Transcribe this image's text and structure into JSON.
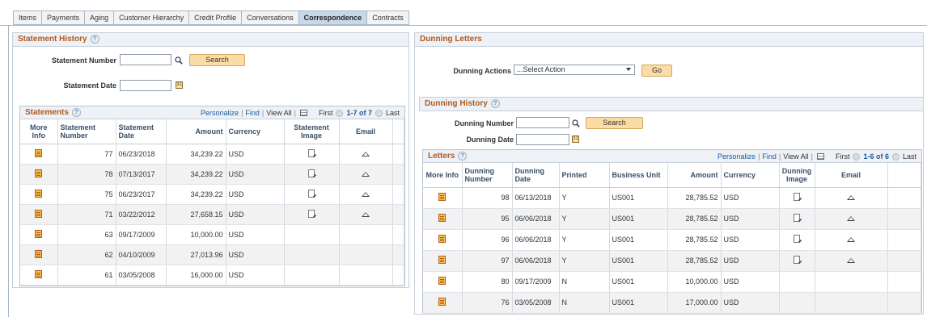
{
  "tabs": [
    "Items",
    "Payments",
    "Aging",
    "Customer Hierarchy",
    "Credit Profile",
    "Conversations",
    "Correspondence",
    "Contracts"
  ],
  "active_tab": "Correspondence",
  "statement_history": {
    "title": "Statement History",
    "help": "?",
    "statement_number_label": "Statement Number",
    "statement_date_label": "Statement Date",
    "search_label": "Search",
    "grid": {
      "title": "Statements",
      "personalize": "Personalize",
      "find": "Find",
      "view_all": "View All",
      "first": "First",
      "range": "1-7 of 7",
      "last": "Last",
      "headers": [
        "More Info",
        "Statement Number",
        "Statement Date",
        "Amount",
        "Currency",
        "Statement Image",
        "Email"
      ],
      "rows": [
        {
          "number": "77",
          "date": "06/23/2018",
          "amount": "34,239.22",
          "currency": "USD",
          "image": true,
          "email": true
        },
        {
          "number": "78",
          "date": "07/13/2017",
          "amount": "34,239.22",
          "currency": "USD",
          "image": true,
          "email": true
        },
        {
          "number": "75",
          "date": "06/23/2017",
          "amount": "34,239.22",
          "currency": "USD",
          "image": true,
          "email": true
        },
        {
          "number": "71",
          "date": "03/22/2012",
          "amount": "27,658.15",
          "currency": "USD",
          "image": true,
          "email": true
        },
        {
          "number": "63",
          "date": "09/17/2009",
          "amount": "10,000.00",
          "currency": "USD",
          "image": false,
          "email": false
        },
        {
          "number": "62",
          "date": "04/10/2009",
          "amount": "27,013.96",
          "currency": "USD",
          "image": false,
          "email": false
        },
        {
          "number": "61",
          "date": "03/05/2008",
          "amount": "16,000.00",
          "currency": "USD",
          "image": false,
          "email": false
        }
      ]
    }
  },
  "dunning_letters": {
    "title": "Dunning Letters",
    "actions_label": "Dunning Actions",
    "actions_value": "...Select Action",
    "go_label": "Go"
  },
  "dunning_history": {
    "title": "Dunning History",
    "help": "?",
    "number_label": "Dunning Number",
    "date_label": "Dunning Date",
    "search_label": "Search",
    "grid": {
      "title": "Letters",
      "personalize": "Personalize",
      "find": "Find",
      "view_all": "View All",
      "first": "First",
      "range": "1-6 of 6",
      "last": "Last",
      "headers": [
        "More Info",
        "Dunning Number",
        "Dunning Date",
        "Printed",
        "Business Unit",
        "Amount",
        "Currency",
        "Dunning Image",
        "Email"
      ],
      "rows": [
        {
          "number": "98",
          "date": "06/13/2018",
          "printed": "Y",
          "bu": "US001",
          "amount": "28,785.52",
          "currency": "USD",
          "image": true,
          "email": true
        },
        {
          "number": "95",
          "date": "06/06/2018",
          "printed": "Y",
          "bu": "US001",
          "amount": "28,785.52",
          "currency": "USD",
          "image": true,
          "email": true
        },
        {
          "number": "96",
          "date": "06/06/2018",
          "printed": "Y",
          "bu": "US001",
          "amount": "28,785.52",
          "currency": "USD",
          "image": true,
          "email": true
        },
        {
          "number": "97",
          "date": "06/06/2018",
          "printed": "Y",
          "bu": "US001",
          "amount": "28,785.52",
          "currency": "USD",
          "image": true,
          "email": true
        },
        {
          "number": "80",
          "date": "09/17/2009",
          "printed": "N",
          "bu": "US001",
          "amount": "10,000.00",
          "currency": "USD",
          "image": false,
          "email": false
        },
        {
          "number": "76",
          "date": "03/05/2008",
          "printed": "N",
          "bu": "US001",
          "amount": "17,000.00",
          "currency": "USD",
          "image": false,
          "email": false
        }
      ]
    }
  }
}
